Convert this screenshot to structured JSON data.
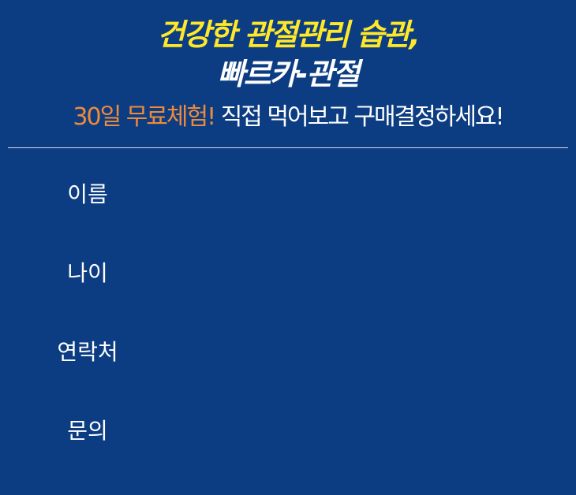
{
  "header": {
    "headline_line1": "건강한 관절관리 습관,",
    "headline_line2": "빠르카-관절",
    "sub_accent": "30일 무료체험!",
    "sub_rest": "직접 먹어보고 구매결정하세요!"
  },
  "form": {
    "fields": [
      {
        "label": "이름",
        "value": ""
      },
      {
        "label": "나이",
        "value": ""
      },
      {
        "label": "연락처",
        "value": ""
      },
      {
        "label": "문의",
        "value": ""
      }
    ]
  },
  "colors": {
    "background": "#0c3d82",
    "headline_yellow": "#ffe82a",
    "accent_orange": "#ef8a3a",
    "text": "#ffffff"
  }
}
